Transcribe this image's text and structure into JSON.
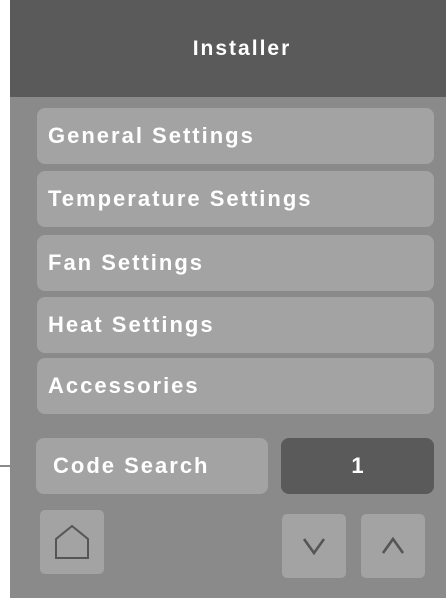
{
  "header": {
    "title": "Installer"
  },
  "menu": {
    "items": [
      {
        "label": "General Settings"
      },
      {
        "label": "Temperature Settings"
      },
      {
        "label": "Fan Settings"
      },
      {
        "label": "Heat Settings"
      },
      {
        "label": "Accessories"
      }
    ]
  },
  "code_search": {
    "label": "Code Search",
    "value": "1"
  },
  "nav": {
    "home_icon": "home-icon",
    "down_icon": "chevron-down-icon",
    "up_icon": "chevron-up-icon"
  },
  "colors": {
    "header_bg": "#5a5a5a",
    "panel_bg": "#8a8a8a",
    "button_bg": "#a3a3a3",
    "value_bg": "#5a5a5a",
    "text": "#ffffff"
  }
}
